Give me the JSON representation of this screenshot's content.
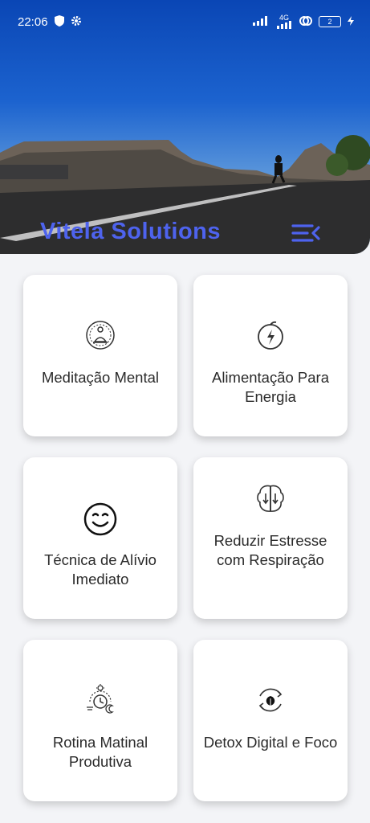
{
  "status_bar": {
    "time": "22:06",
    "network": "4G",
    "battery": "2"
  },
  "header": {
    "title": "Vitela Solutions",
    "menu_icon": "menu-collapse-icon"
  },
  "cards": [
    {
      "label": "Meditação Mental",
      "icon": "meditation-icon"
    },
    {
      "label": "Alimentação Para Energia",
      "icon": "apple-energy-icon"
    },
    {
      "label": "Técnica de Alívio Imediato",
      "icon": "smile-icon"
    },
    {
      "label": "Reduzir Estresse com Respiração",
      "icon": "brain-breath-icon"
    },
    {
      "label": "Rotina Matinal Produtiva",
      "icon": "daily-routine-icon"
    },
    {
      "label": "Detox Digital e Foco",
      "icon": "leaf-cycle-icon"
    }
  ],
  "colors": {
    "accent": "#4e63ee",
    "card_bg": "#ffffff",
    "page_bg": "#f3f4f7"
  }
}
